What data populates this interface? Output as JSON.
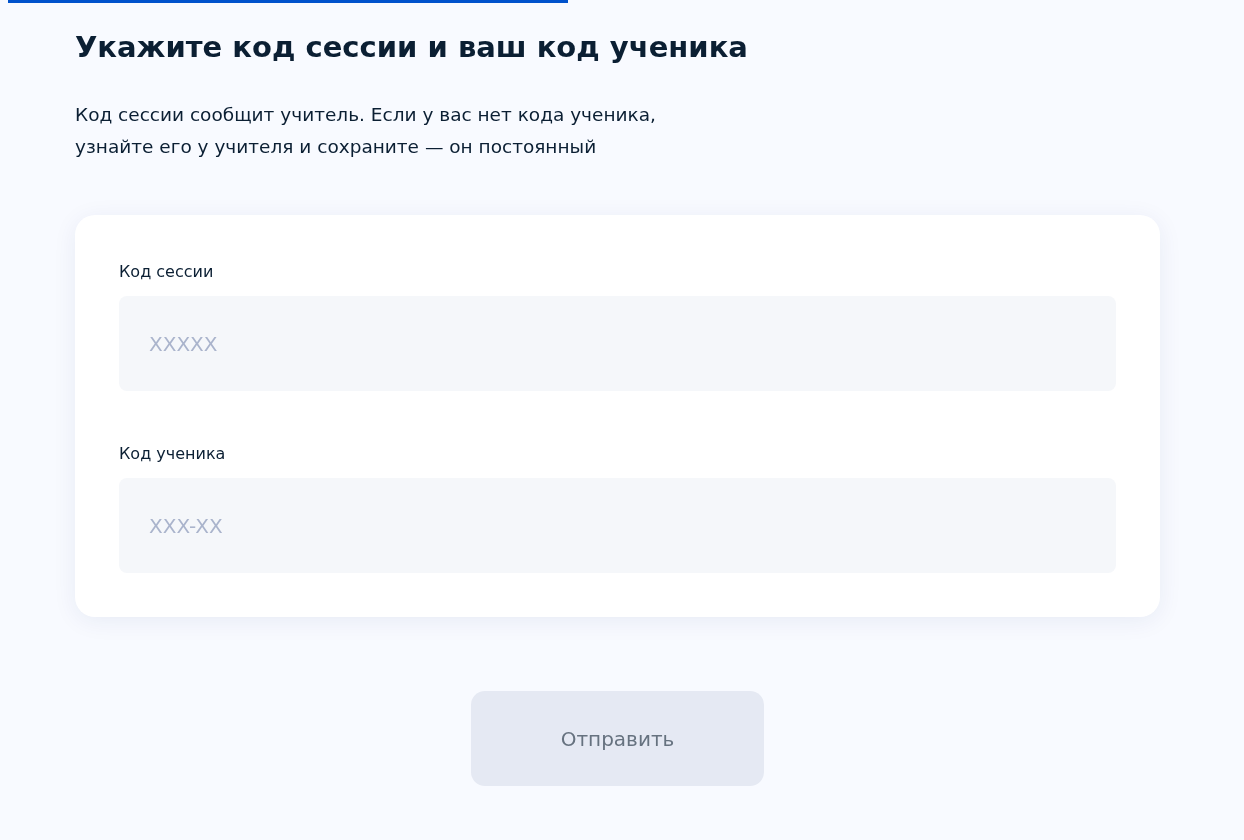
{
  "title": "Укажите код сессии и ваш код ученика",
  "description": "Код сессии сообщит учитель. Если у вас нет кода ученика, узнайте его у учителя и сохраните — он постоянный",
  "fields": [
    {
      "label": "Код сессии",
      "placeholder": "XXXXX"
    },
    {
      "label": "Код ученика",
      "placeholder": "XXX-XX"
    }
  ],
  "submit": {
    "label": "Отправить",
    "disabled": true
  }
}
